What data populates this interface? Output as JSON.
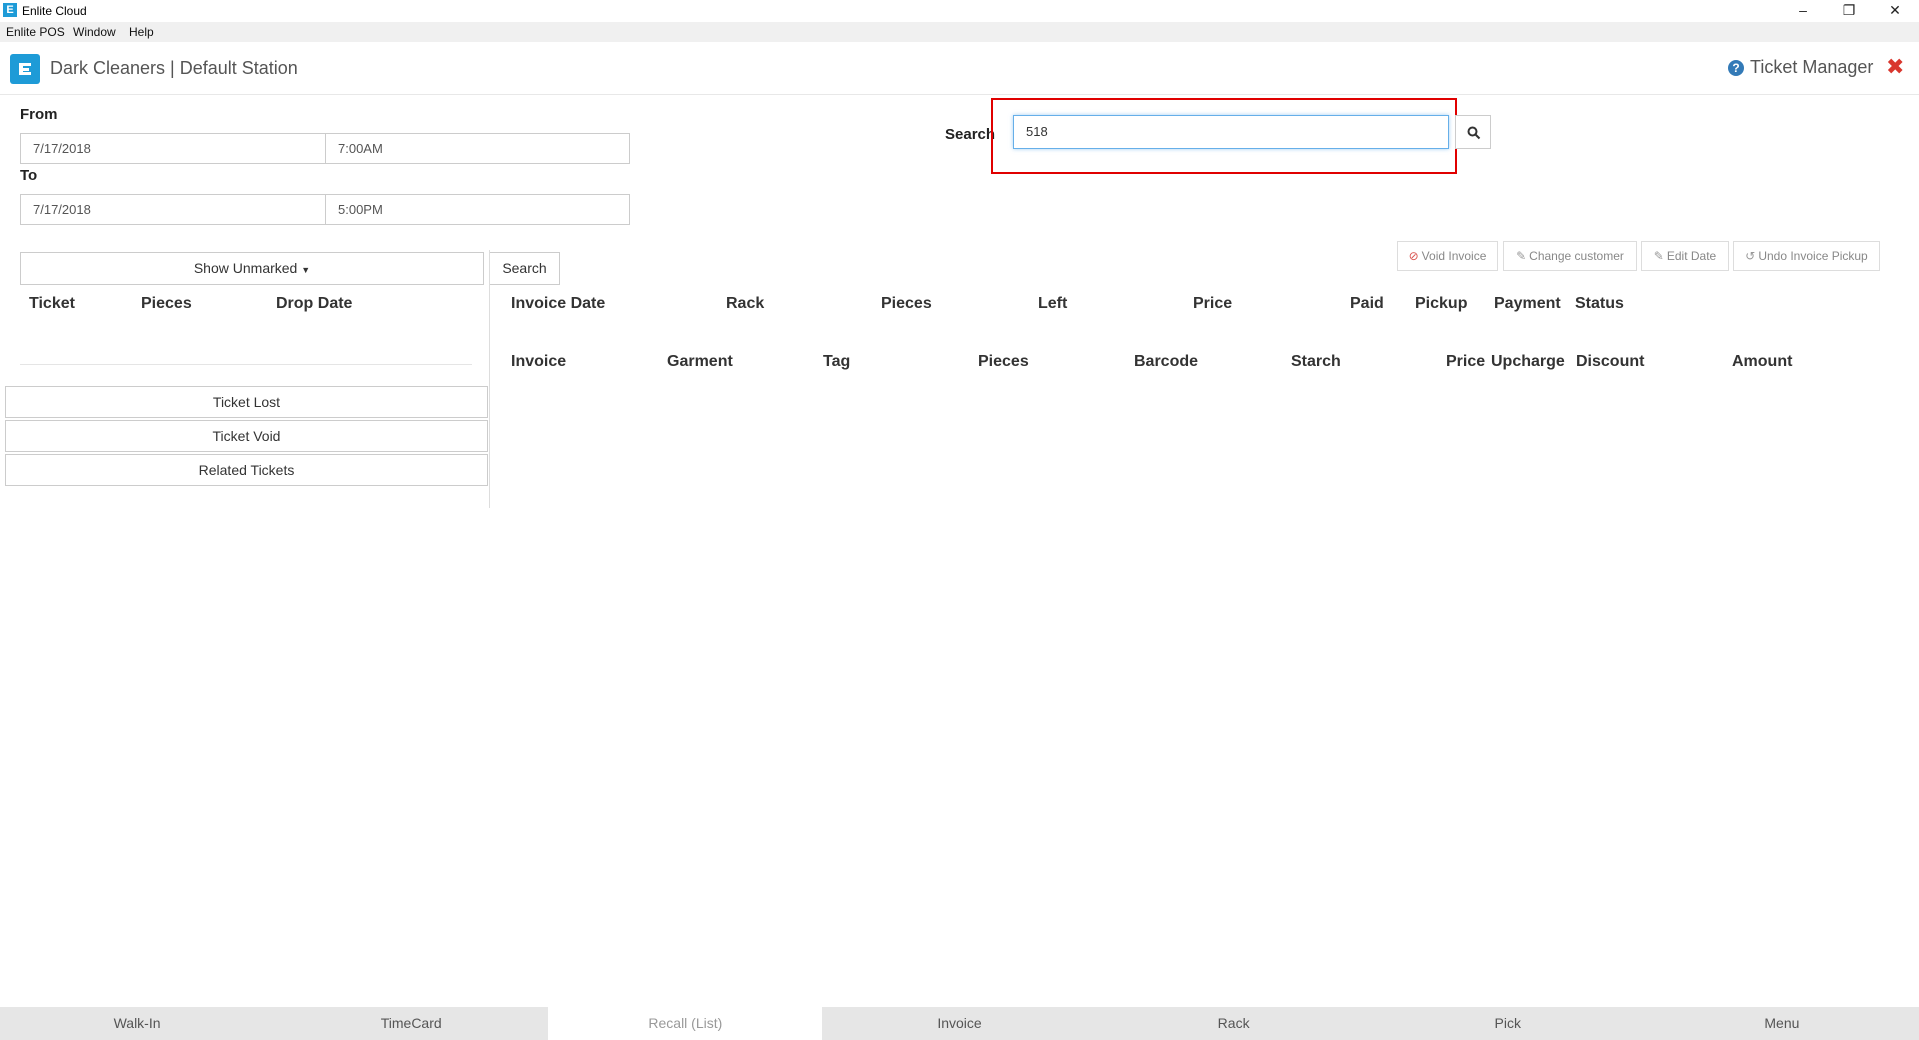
{
  "window": {
    "title": "Enlite Cloud",
    "app_icon_letter": "E",
    "minimize": "–",
    "restore": "❐",
    "close": "✕"
  },
  "menu": [
    "Enlite POS",
    "Window",
    "Help"
  ],
  "header": {
    "company": "Dark Cleaners | Default Station",
    "screen_title": "Ticket Manager",
    "help_icon": "?",
    "close_icon": "✖"
  },
  "filters": {
    "from_label": "From",
    "from_date": "7/17/2018",
    "from_time": "7:00AM",
    "to_label": "To",
    "to_date": "7/17/2018",
    "to_time": "5:00PM",
    "show_dropdown": "Show Unmarked",
    "search_button": "Search"
  },
  "search": {
    "label": "Search",
    "value": "518"
  },
  "actions": {
    "void_invoice": "Void Invoice",
    "change_customer": "Change customer",
    "edit_date": "Edit Date",
    "undo_pickup": "Undo Invoice Pickup"
  },
  "ticket_table": {
    "headers": [
      "Ticket",
      "Pieces",
      "Drop Date"
    ]
  },
  "ticket_buttons": [
    "Ticket Lost",
    "Ticket Void",
    "Related Tickets"
  ],
  "invoice_table": {
    "headers": [
      "Invoice Date",
      "Rack",
      "Pieces",
      "Left",
      "Price",
      "Paid",
      "Pickup",
      "Payment",
      "Status"
    ]
  },
  "garment_table": {
    "headers": [
      "Invoice",
      "Garment",
      "Tag",
      "Pieces",
      "Barcode",
      "Starch",
      "Price",
      "Upcharge",
      "Discount",
      "Amount"
    ]
  },
  "bottom_nav": [
    "Walk-In",
    "TimeCard",
    "Recall (List)",
    "Invoice",
    "Rack",
    "Pick",
    "Menu"
  ],
  "active_tab": "Recall (List)",
  "colors": {
    "accent": "#1e9bd7",
    "highlight_frame": "#e00000",
    "close": "#d9362d"
  }
}
